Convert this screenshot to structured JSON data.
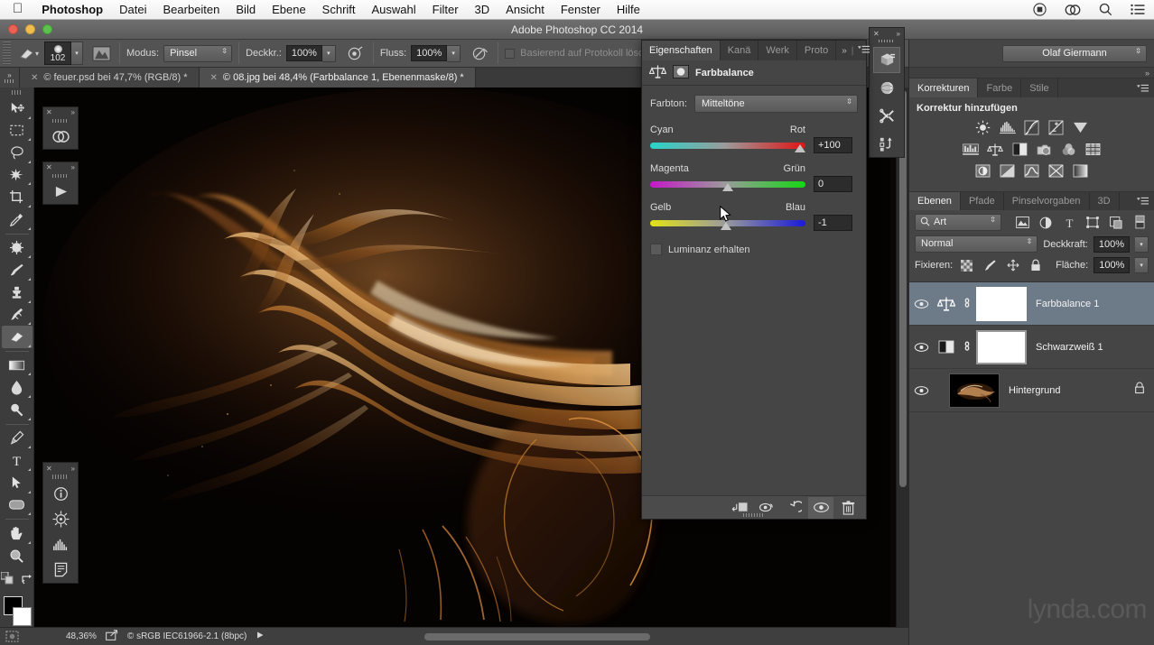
{
  "menubar": {
    "apple_icon": "apple-logo",
    "items": [
      {
        "label": "Photoshop",
        "bold": true
      },
      {
        "label": "Datei",
        "bold": false
      },
      {
        "label": "Bearbeiten",
        "bold": false
      },
      {
        "label": "Bild",
        "bold": false
      },
      {
        "label": "Ebene",
        "bold": false
      },
      {
        "label": "Schrift",
        "bold": false
      },
      {
        "label": "Auswahl",
        "bold": false
      },
      {
        "label": "Filter",
        "bold": false
      },
      {
        "label": "3D",
        "bold": false
      },
      {
        "label": "Ansicht",
        "bold": false
      },
      {
        "label": "Fenster",
        "bold": false
      },
      {
        "label": "Hilfe",
        "bold": false
      }
    ],
    "right_icons": [
      "record-icon",
      "creative-cloud-icon",
      "search-icon",
      "list-icon"
    ]
  },
  "window": {
    "title": "Adobe Photoshop CC 2014",
    "controls": [
      "close-button",
      "minimize-button",
      "zoom-button"
    ]
  },
  "options_bar": {
    "tool_icon": "eraser-tool-icon",
    "brush_size": "102",
    "brush_preset_icon": "brush-preset-picker-icon",
    "mode_label": "Modus:",
    "mode_value": "Pinsel",
    "opacity_label": "Deckkr.:",
    "opacity_value": "100%",
    "airbrush_icon": "airbrush-icon",
    "flow_label": "Fluss:",
    "flow_value": "100%",
    "tablet_pressure_icon": "tablet-pressure-icon",
    "history_checkbox_label": "Basierend auf Protokoll lösch"
  },
  "document_tabs": [
    {
      "label": "© feuer.psd bei 47,7% (RGB/8) *",
      "active": false
    },
    {
      "label": "© 08.jpg bei 48,4% (Farbbalance 1, Ebenenmaske/8) *",
      "active": true
    }
  ],
  "toolbar": {
    "tools": [
      {
        "name": "move-tool",
        "glyph": "move",
        "selected": false,
        "has_flyout": true
      },
      {
        "name": "rectangular-marquee-tool",
        "glyph": "marquee",
        "selected": false,
        "has_flyout": true
      },
      {
        "name": "lasso-tool",
        "glyph": "lasso",
        "selected": false,
        "has_flyout": true
      },
      {
        "name": "quick-selection-tool",
        "glyph": "wand",
        "selected": false,
        "has_flyout": true
      },
      {
        "name": "crop-tool",
        "glyph": "crop",
        "selected": false,
        "has_flyout": true
      },
      {
        "name": "eyedropper-tool",
        "glyph": "eyedropper",
        "selected": false,
        "has_flyout": true
      },
      {
        "name": "spot-healing-brush-tool",
        "glyph": "healing",
        "selected": false,
        "has_flyout": true
      },
      {
        "name": "brush-tool",
        "glyph": "brush",
        "selected": false,
        "has_flyout": true
      },
      {
        "name": "clone-stamp-tool",
        "glyph": "stamp",
        "selected": false,
        "has_flyout": true
      },
      {
        "name": "history-brush-tool",
        "glyph": "historybrush",
        "selected": false,
        "has_flyout": true
      },
      {
        "name": "eraser-tool",
        "glyph": "eraser",
        "selected": true,
        "has_flyout": true
      },
      {
        "name": "gradient-tool",
        "glyph": "gradient",
        "selected": false,
        "has_flyout": true
      },
      {
        "name": "blur-tool",
        "glyph": "blur",
        "selected": false,
        "has_flyout": true
      },
      {
        "name": "dodge-tool",
        "glyph": "dodge",
        "selected": false,
        "has_flyout": true
      },
      {
        "name": "pen-tool",
        "glyph": "pen",
        "selected": false,
        "has_flyout": true
      },
      {
        "name": "type-tool",
        "glyph": "type",
        "selected": false,
        "has_flyout": true
      },
      {
        "name": "path-selection-tool",
        "glyph": "arrow",
        "selected": false,
        "has_flyout": true
      },
      {
        "name": "rounded-rectangle-tool",
        "glyph": "shape",
        "selected": false,
        "has_flyout": true
      },
      {
        "name": "hand-tool",
        "glyph": "hand",
        "selected": false,
        "has_flyout": true
      },
      {
        "name": "zoom-tool",
        "glyph": "zoom",
        "selected": false,
        "has_flyout": false
      }
    ],
    "foreground_color": "#000000",
    "background_color": "#ffffff",
    "swap_icon": "swap-colors-icon",
    "default_colors_icon": "default-colors-icon"
  },
  "canvas_panels": [
    {
      "name": "creative-cloud-mini-panel",
      "icon": "creative-cloud-icon"
    },
    {
      "name": "play-mini-panel",
      "icon": "play-icon"
    },
    {
      "name": "tools-mini-panel",
      "icons": [
        "info-icon",
        "navigator-icon",
        "histogram-icon",
        "notes-icon"
      ]
    }
  ],
  "properties_panel": {
    "tabs": [
      {
        "label": "Eigenschaften",
        "active": true
      },
      {
        "label": "Kanä",
        "active": false
      },
      {
        "label": "Werk",
        "active": false
      },
      {
        "label": "Proto",
        "active": false
      }
    ],
    "overflow_icon": "chevron-double-right-icon",
    "menu_icon": "panel-menu-icon",
    "title": "Farbbalance",
    "title_icon": "color-balance-icon",
    "mask_icon": "layer-mask-icon",
    "tone_label": "Farbton:",
    "tone_value": "Mitteltöne",
    "sliders": [
      {
        "name": "cyan-red-slider",
        "left_label": "Cyan",
        "right_label": "Rot",
        "value": "+100",
        "position_pct": 100
      },
      {
        "name": "magenta-green-slider",
        "left_label": "Magenta",
        "right_label": "Grün",
        "value": "0",
        "position_pct": 50
      },
      {
        "name": "yellow-blue-slider",
        "left_label": "Gelb",
        "right_label": "Blau",
        "value": "-1",
        "position_pct": 49
      }
    ],
    "luminance_label": "Luminanz erhalten",
    "luminance_checked": false,
    "footer_icons": [
      "clip-to-layer-icon",
      "view-previous-state-icon",
      "reset-icon",
      "toggle-visibility-icon",
      "delete-icon"
    ]
  },
  "dock_strip": {
    "icons": [
      "library-icon",
      "3d-icon",
      "tools-icon",
      "actions-icon"
    ],
    "close_icon": "close-icon",
    "expand_icon": "chevron-double-right-icon"
  },
  "right_dock": {
    "user_name": "Olaf Giermann",
    "collapse_icon": "chevron-double-right-icon",
    "corrections": {
      "tabs": [
        {
          "label": "Korrekturen",
          "active": true
        },
        {
          "label": "Farbe",
          "active": false
        },
        {
          "label": "Stile",
          "active": false
        }
      ],
      "heading": "Korrektur hinzufügen",
      "icon_rows": [
        [
          "brightness-contrast-icon",
          "levels-icon",
          "curves-icon",
          "exposure-icon",
          "vibrance-icon"
        ],
        [
          "hue-saturation-icon",
          "color-balance-icon",
          "black-white-icon",
          "photo-filter-icon",
          "channel-mixer-icon",
          "color-lookup-icon"
        ],
        [
          "invert-icon",
          "posterize-icon",
          "threshold-icon",
          "selective-color-icon",
          "gradient-map-icon"
        ]
      ]
    },
    "layers": {
      "tabs": [
        {
          "label": "Ebenen",
          "active": true
        },
        {
          "label": "Pfade",
          "active": false
        },
        {
          "label": "Pinselvorgaben",
          "active": false
        },
        {
          "label": "3D",
          "active": false
        }
      ],
      "filter_label": "Art",
      "filter_icons": [
        "filter-pixel-icon",
        "filter-adjustment-icon",
        "filter-type-icon",
        "filter-shape-icon",
        "filter-smart-icon"
      ],
      "filter_toggle_icon": "filter-toggle-icon",
      "blend_mode": "Normal",
      "opacity_label": "Deckkraft:",
      "opacity_value": "100%",
      "lock_label": "Fixieren:",
      "lock_icons": [
        "lock-transparency-icon",
        "lock-image-icon",
        "lock-position-icon",
        "lock-all-icon"
      ],
      "fill_label": "Fläche:",
      "fill_value": "100%",
      "rows": [
        {
          "name": "Farbbalance 1",
          "selected": true,
          "visible": true,
          "kind": "adjustment",
          "adj_icon": "color-balance-icon",
          "linked": true,
          "locked": false
        },
        {
          "name": "Schwarzweiß 1",
          "selected": false,
          "visible": true,
          "kind": "adjustment",
          "adj_icon": "black-white-icon",
          "linked": true,
          "locked": false
        },
        {
          "name": "Hintergrund",
          "selected": false,
          "visible": true,
          "kind": "image",
          "linked": false,
          "locked": true
        }
      ]
    },
    "watermark": "lynda.com"
  },
  "status_bar": {
    "zoom": "48,36%",
    "share_icon": "share-icon",
    "profile": "© sRGB IEC61966-2.1 (8bpc)",
    "arrow_icon": "play-triangle-icon"
  }
}
